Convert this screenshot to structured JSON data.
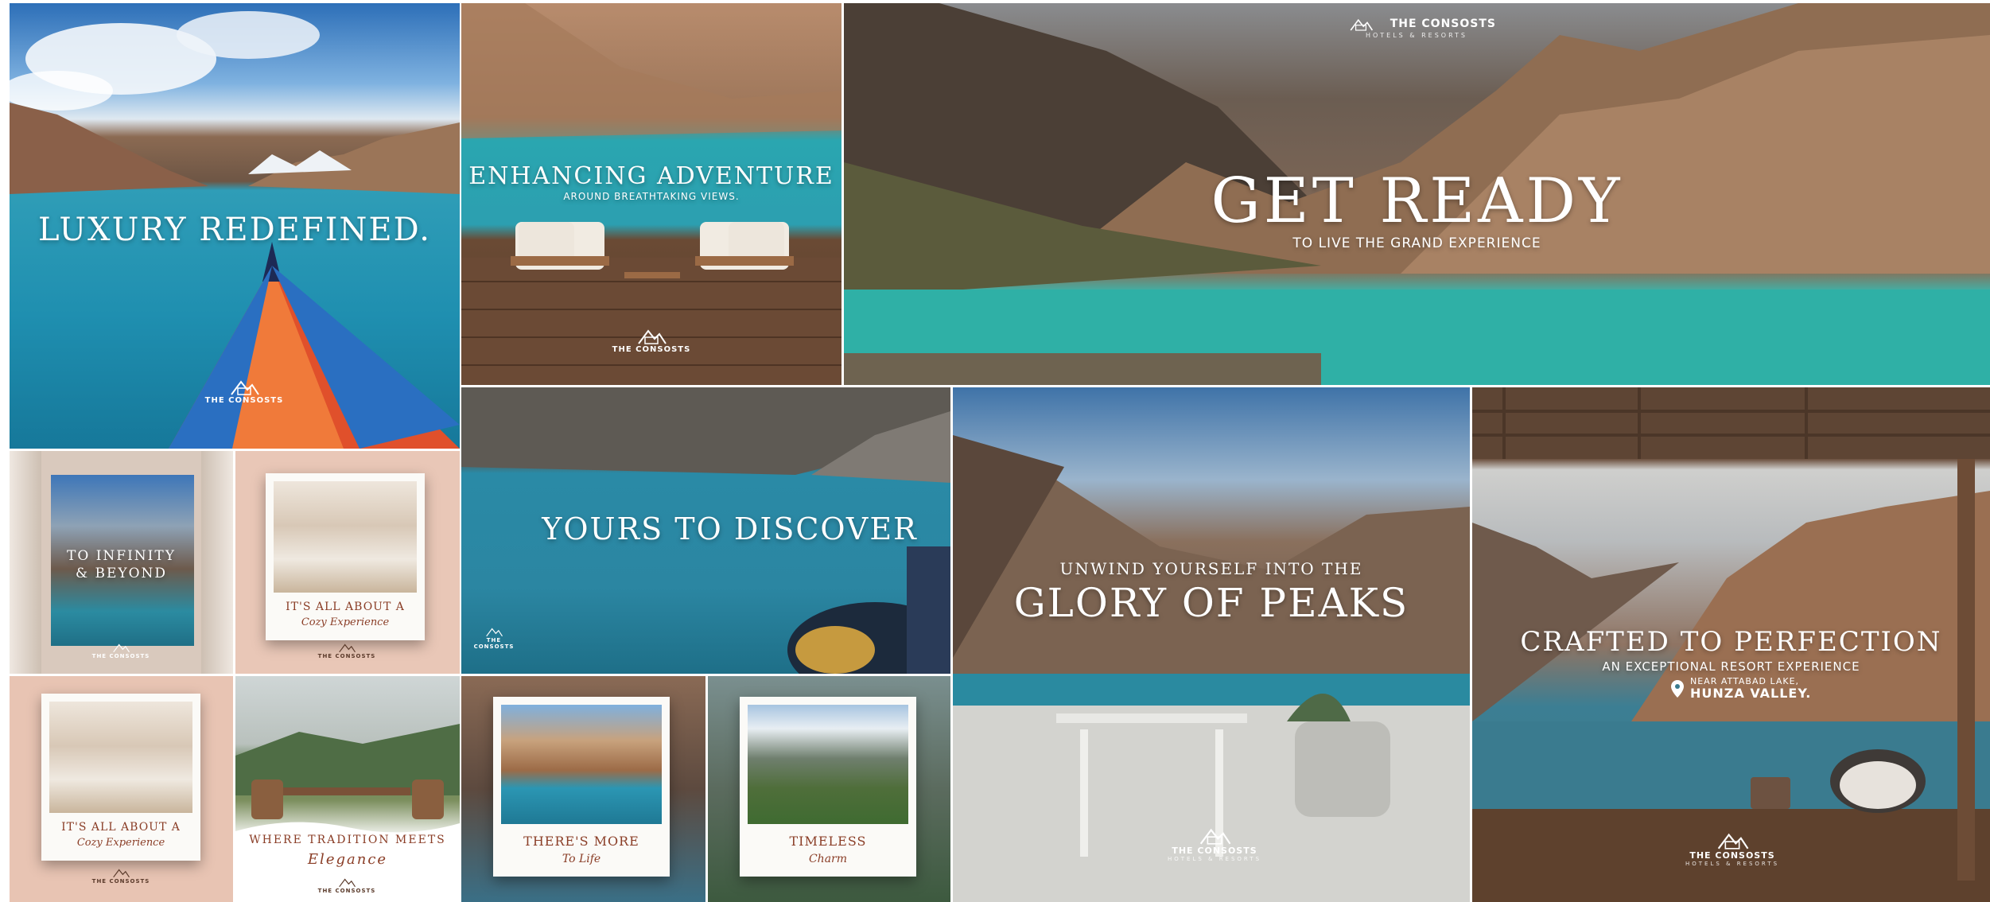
{
  "brand": {
    "name": "THE CONSOSTS",
    "tagline": "HOTELS & RESORTS"
  },
  "tiles": {
    "luxury": {
      "title": "LUXURY REDEFINED."
    },
    "adventure": {
      "title": "ENHANCING ADVENTURE",
      "subtitle": "AROUND BREATHTAKING VIEWS."
    },
    "get_ready": {
      "title": "GET READY",
      "subtitle": "TO LIVE THE GRAND EXPERIENCE"
    },
    "infinity": {
      "line1": "TO INFINITY",
      "line2": "& BEYOND"
    },
    "cozy_top": {
      "line1": "IT'S ALL ABOUT A",
      "line2": "Cozy Experience"
    },
    "cozy_bottom": {
      "line1": "IT'S ALL ABOUT A",
      "line2": "Cozy Experience"
    },
    "tradition": {
      "line1": "WHERE TRADITION MEETS",
      "line2": "Elegance"
    },
    "discover": {
      "title": "YOURS TO DISCOVER"
    },
    "peaks": {
      "line1": "UNWIND YOURSELF INTO THE",
      "line2": "GLORY OF PEAKS"
    },
    "crafted": {
      "title": "CRAFTED TO PERFECTION",
      "subtitle": "AN EXCEPTIONAL RESORT EXPERIENCE",
      "loc1": "NEAR ATTABAD LAKE,",
      "loc2": "HUNZA VALLEY."
    },
    "more": {
      "line1": "THERE'S MORE",
      "line2": "To Life"
    },
    "timeless": {
      "line1": "TIMELESS",
      "line2": "Charm"
    }
  }
}
